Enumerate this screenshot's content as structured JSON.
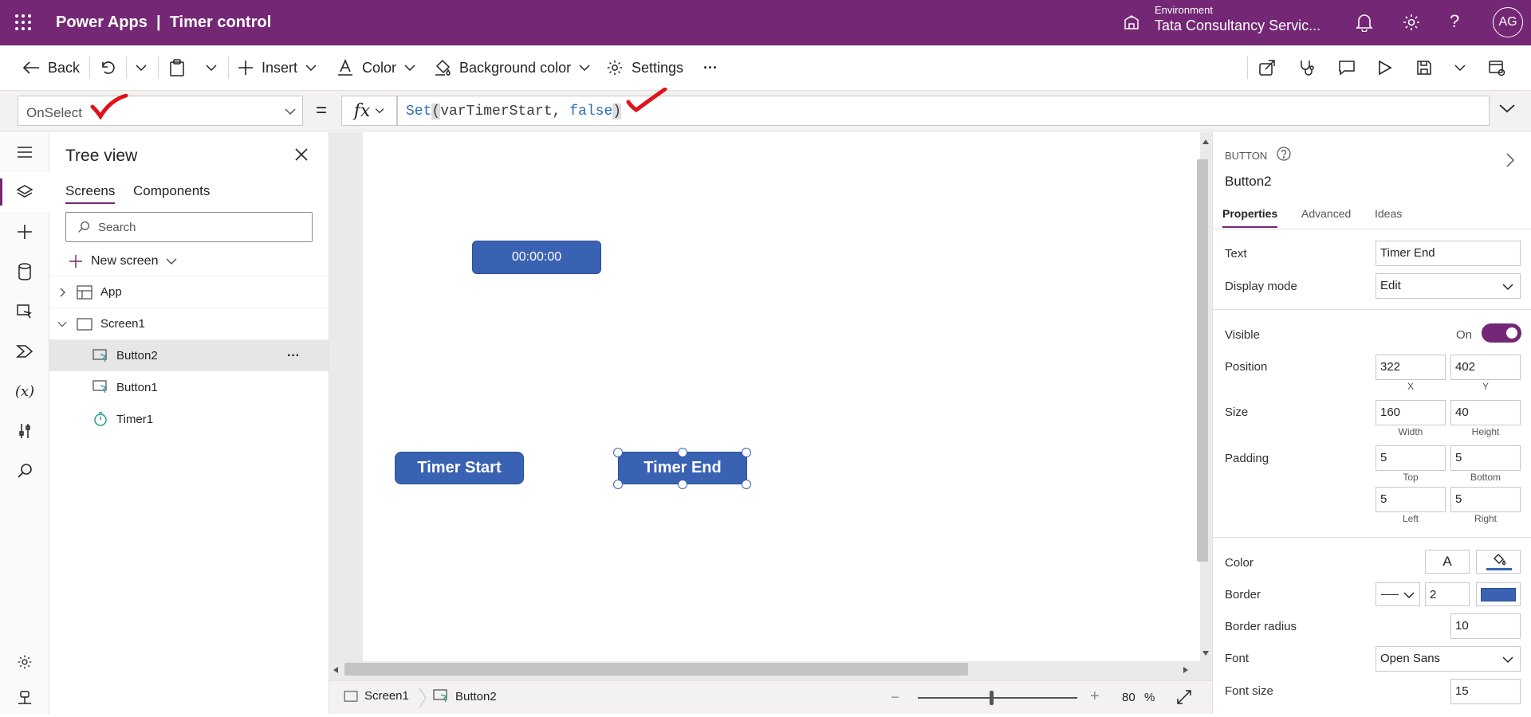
{
  "app": {
    "name": "Power Apps",
    "separator": "|",
    "doc_title": "Timer control"
  },
  "header": {
    "environment_label": "Environment",
    "environment_value": "Tata Consultancy Servic...",
    "avatar": "AG"
  },
  "commandbar": {
    "back": "Back",
    "insert": "Insert",
    "color": "Color",
    "background_color": "Background color",
    "settings": "Settings",
    "more": "···"
  },
  "formula": {
    "property": "OnSelect",
    "equals": "=",
    "fx": "fx",
    "fn": "Set",
    "open": "(",
    "arg1": "varTimerStart, ",
    "arg2": "false",
    "close": ")"
  },
  "tree": {
    "title": "Tree view",
    "tabs": [
      "Screens",
      "Components"
    ],
    "search_placeholder": "Search",
    "new_screen": "New screen",
    "nodes": [
      "App",
      "Screen1",
      "Button2",
      "Button1",
      "Timer1"
    ],
    "node_more": "···"
  },
  "canvas": {
    "timer_text": "00:00:00",
    "btn_start": "Timer Start",
    "btn_end": "Timer End"
  },
  "bottombar": {
    "crumb_screen": "Screen1",
    "crumb_control": "Button2",
    "zoom": "80",
    "zoom_unit": "%",
    "zoom_level": 0.46
  },
  "props": {
    "type": "BUTTON",
    "name": "Button2",
    "tabs": [
      "Properties",
      "Advanced",
      "Ideas"
    ],
    "text_label": "Text",
    "text_value": "Timer End",
    "display_mode_label": "Display mode",
    "display_mode_value": "Edit",
    "visible_label": "Visible",
    "visible_state": "On",
    "position_label": "Position",
    "x": "322",
    "y": "402",
    "x_sub": "X",
    "y_sub": "Y",
    "size_label": "Size",
    "width": "160",
    "height": "40",
    "width_sub": "Width",
    "height_sub": "Height",
    "padding_label": "Padding",
    "pad_top": "5",
    "pad_bottom": "5",
    "pad_left": "5",
    "pad_right": "5",
    "pad_top_sub": "Top",
    "pad_bottom_sub": "Bottom",
    "pad_left_sub": "Left",
    "pad_right_sub": "Right",
    "color_label": "Color",
    "color_text_glyph": "A",
    "border_label": "Border",
    "border_width": "2",
    "border_radius_label": "Border radius",
    "border_radius": "10",
    "font_label": "Font",
    "font_value": "Open Sans",
    "font_size_label": "Font size",
    "font_size": "15"
  },
  "colors": {
    "brand": "#742774",
    "button_fill": "#3a62b3",
    "check_mark": "#e0121a"
  }
}
